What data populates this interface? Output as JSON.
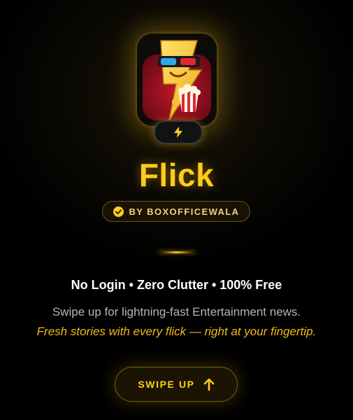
{
  "app": {
    "title": "Flick",
    "publisher": "BY BOXOFFICEWALA",
    "icon": "flick-mascot-icon",
    "badge_icon": "lightning-bolt-icon"
  },
  "content": {
    "features": "No Login • Zero Clutter • 100% Free",
    "description": "Swipe up for lightning-fast Entertainment news.",
    "tagline": "Fresh stories with every flick — right at your fingertip."
  },
  "cta": {
    "label": "SWIPE UP",
    "icon": "arrow-up-icon"
  },
  "colors": {
    "background": "#000000",
    "accent": "#ffcc1a",
    "tagline": "#f0b91a",
    "body_text": "#b5b5b5",
    "heading_text": "#ffffff"
  }
}
